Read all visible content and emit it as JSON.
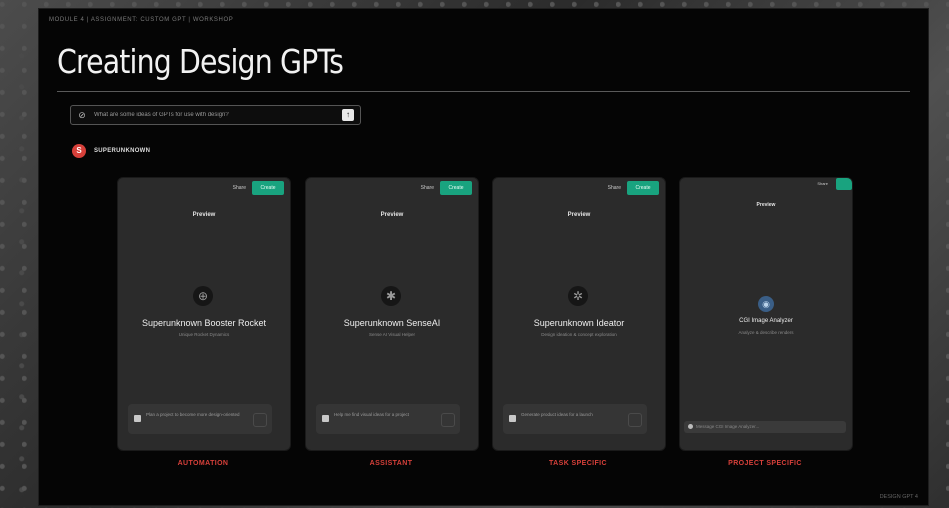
{
  "slide": {
    "breadcrumb": "MODULE 4 | ASSIGNMENT: CUSTOM GPT | WORKSHOP",
    "slide_number_top": "",
    "title": "Creating Design GPTs",
    "footer_left": "",
    "footer_right": "DESIGN GPT 4"
  },
  "prompt_bar": {
    "placeholder": "What are some ideas of GPTs for use with design?",
    "send_icon": "↑"
  },
  "author": {
    "initial": "S",
    "name": "SUPERUNKNOWN"
  },
  "cards": [
    {
      "topbar_text": "",
      "share_label": "Share",
      "create_label": "Create",
      "preview_label": "Preview",
      "icon": "crosshair-icon",
      "name": "Superunknown Booster Rocket",
      "subtitle": "Unique Rocket Dynamics",
      "starter_text": "Plan a project to become more design-oriented",
      "caption": "AUTOMATION"
    },
    {
      "topbar_text": "",
      "share_label": "Share",
      "create_label": "Create",
      "preview_label": "Preview",
      "icon": "spider-icon",
      "name": "Superunknown SenseAI",
      "subtitle": "Sense AI Visual Helper",
      "starter_text": "Help me find visual ideas for a project",
      "caption": "ASSISTANT"
    },
    {
      "topbar_text": "",
      "share_label": "Share",
      "create_label": "Create",
      "preview_label": "Preview",
      "icon": "bug-icon",
      "name": "Superunknown Ideator",
      "subtitle": "Design ideation & concept exploration",
      "starter_text": "Generate product ideas for a launch",
      "caption": "TASK SPECIFIC"
    },
    {
      "topbar_text": "",
      "share_label": "Share",
      "create_label": "",
      "preview_label": "Preview",
      "icon": "globe-icon",
      "name": "CGI Image Analyzer",
      "subtitle": "Analyze & describe renders",
      "input_placeholder": "Message CGI Image Analyzer...",
      "caption": "PROJECT SPECIFIC"
    }
  ]
}
